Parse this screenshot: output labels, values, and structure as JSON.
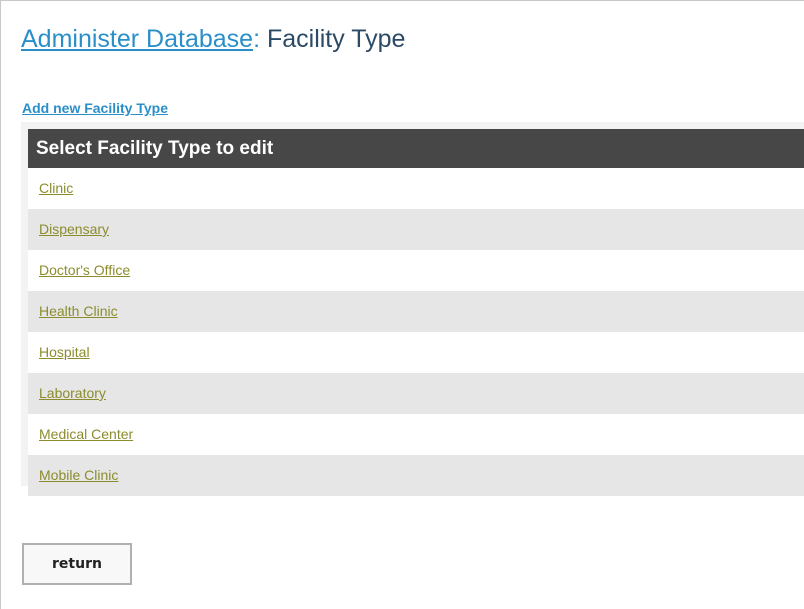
{
  "header": {
    "breadcrumb_link": "Administer Database",
    "separator": ":",
    "title": "Facility Type"
  },
  "actions": {
    "add_link": "Add new Facility Type",
    "return_label": "return"
  },
  "facility_list": {
    "heading": "Select Facility Type to edit",
    "items": [
      {
        "label": "Clinic"
      },
      {
        "label": "Dispensary"
      },
      {
        "label": "Doctor's Office"
      },
      {
        "label": "Health Clinic"
      },
      {
        "label": "Hospital"
      },
      {
        "label": "Laboratory"
      },
      {
        "label": "Medical Center"
      },
      {
        "label": "Mobile Clinic"
      }
    ]
  },
  "colors": {
    "link_blue": "#2a8fc9",
    "item_link": "#8c8c2e",
    "header_bg": "#474747",
    "row_alt": "#e6e6e6"
  }
}
